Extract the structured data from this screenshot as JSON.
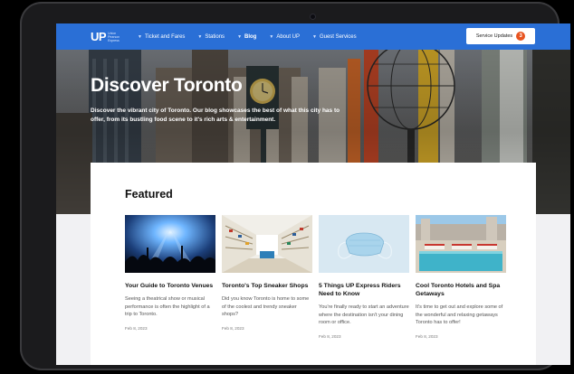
{
  "nav": {
    "logo": {
      "mark": "UP",
      "subtitle": "Union Pearson Express"
    },
    "links": [
      {
        "label": "Ticket and Fares",
        "active": false
      },
      {
        "label": "Stations",
        "active": false
      },
      {
        "label": "Blog",
        "active": true
      },
      {
        "label": "About UP",
        "active": false
      },
      {
        "label": "Guest Services",
        "active": false
      }
    ],
    "service_updates": {
      "label": "Service Updates",
      "count": "3"
    }
  },
  "hero": {
    "title": "Discover Toronto",
    "description": "Discover the vibrant city of Toronto. Our blog showcases the best of what this city has to offer, from its bustling food scene to it's rich arts & entertainment."
  },
  "featured": {
    "title": "Featured",
    "cards": [
      {
        "title": "Your Guide to Toronto Venues",
        "description": "Seeing a theatrical show or musical performance is often the highlight of a trip to Toronto.",
        "date": "Feb 8, 2023"
      },
      {
        "title": "Toronto's Top Sneaker Shops",
        "description": "Did you know Toronto is home to some of the coolest and trendy sneaker shops?",
        "date": "Feb 8, 2023"
      },
      {
        "title": "5 Things UP Express Riders Need to Know",
        "description": "You're finally ready to start an adventure where the destination isn't your dining room or office.",
        "date": "Feb 8, 2023"
      },
      {
        "title": "Cool Toronto Hotels and Spa Getaways",
        "description": "It's time to get out and explore some of the wonderful and relaxing getaways Toronto has to offer!",
        "date": "Feb 8, 2023"
      }
    ]
  },
  "colors": {
    "nav_blue": "#2a6fd6",
    "badge_orange": "#e8531f",
    "hero_banner_orange": "#e5732d",
    "hero_banner_yellow": "#f2c12e"
  }
}
